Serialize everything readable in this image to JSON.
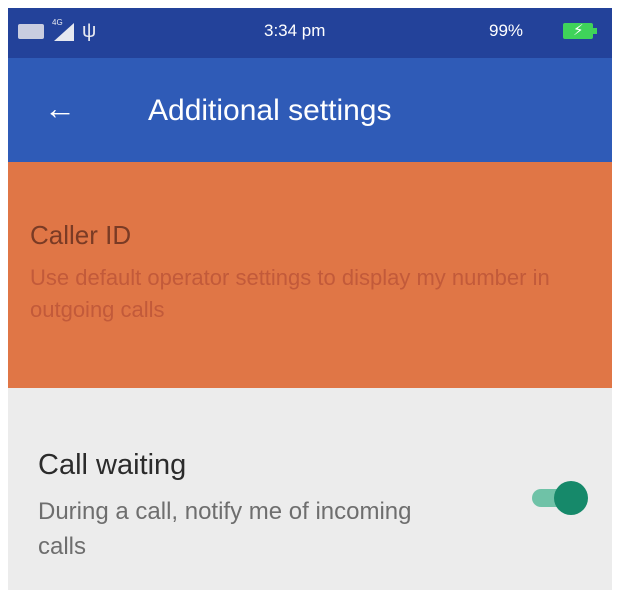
{
  "status_bar": {
    "time": "3:34 pm",
    "battery_percent": "99%",
    "network_label": "4G",
    "icons": [
      "notification-icon",
      "signal-icon",
      "usb-icon",
      "battery-charging-icon"
    ]
  },
  "app_bar": {
    "back_icon": "arrow-left-icon",
    "back_glyph": "←",
    "title": "Additional settings",
    "color": "#2f5bb7"
  },
  "settings": {
    "caller_id": {
      "title": "Caller ID",
      "summary": "Use default operator settings to display my number in outgoing calls",
      "highlight_color": "#e07646"
    },
    "call_waiting": {
      "title": "Call waiting",
      "summary": "During a call, notify me of incoming calls",
      "toggle_on": true,
      "toggle_color": "#16896a"
    }
  }
}
